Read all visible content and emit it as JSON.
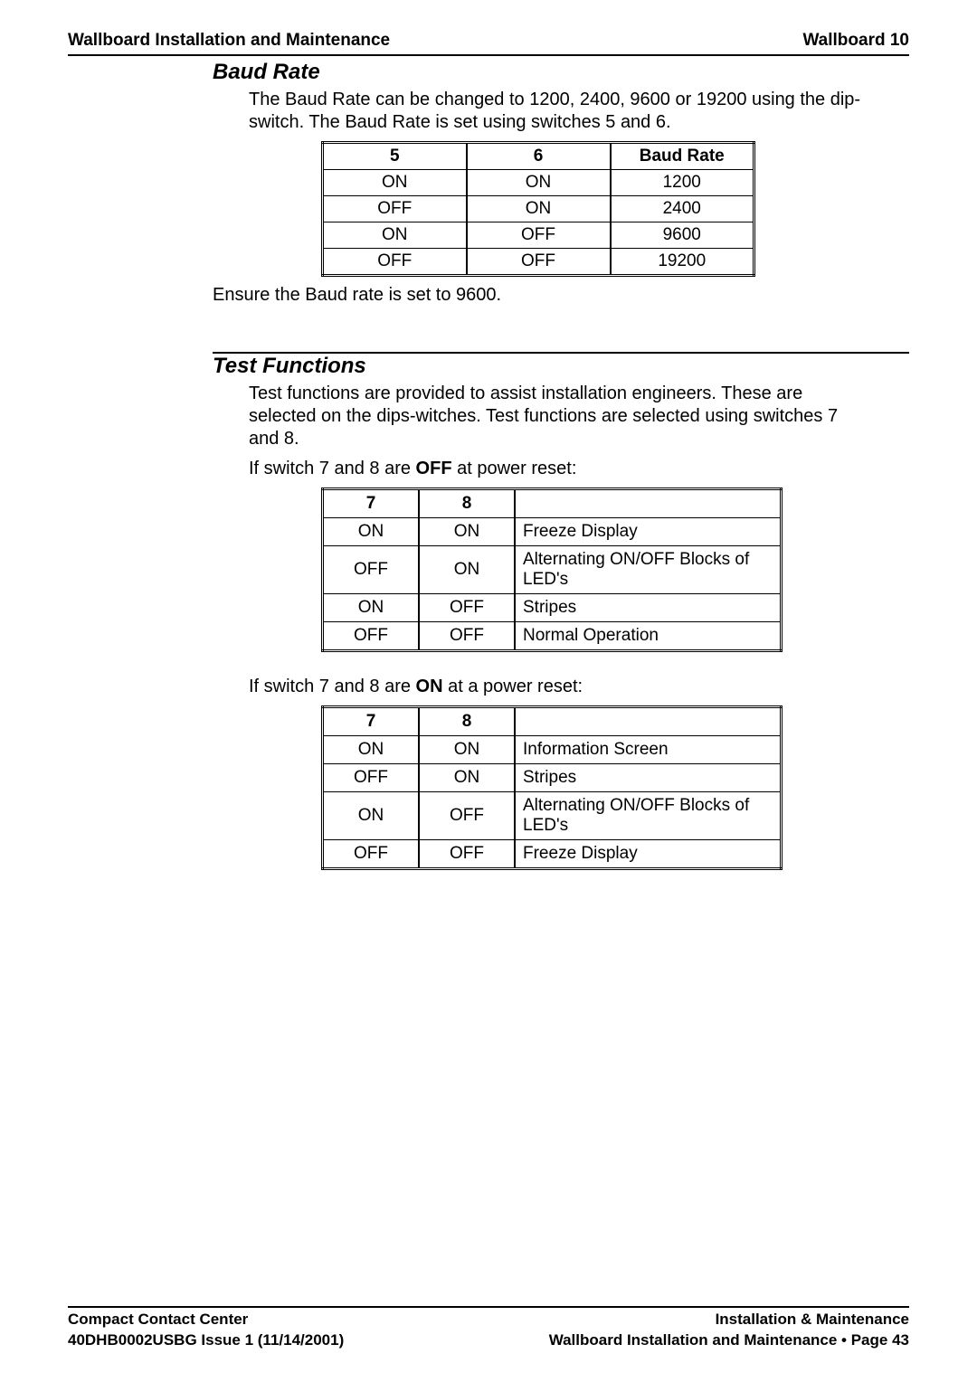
{
  "header": {
    "left": "Wallboard Installation and Maintenance",
    "right": "Wallboard 10"
  },
  "section1": {
    "title": "Baud Rate",
    "intro": "The Baud Rate can be changed to 1200, 2400, 9600 or 19200 using the dip-switch.  The Baud Rate is set using switches 5 and 6.",
    "note": "Ensure the Baud rate is set to 9600."
  },
  "chart_data": [
    {
      "type": "table",
      "title": "Baud Rate dip-switch settings (switches 5 & 6)",
      "headers": [
        "5",
        "6",
        "Baud Rate"
      ],
      "rows": [
        [
          "ON",
          "ON",
          "1200"
        ],
        [
          "OFF",
          "ON",
          "2400"
        ],
        [
          "ON",
          "OFF",
          "9600"
        ],
        [
          "OFF",
          "OFF",
          "19200"
        ]
      ]
    },
    {
      "type": "table",
      "title": "Test functions when switches 7 & 8 are OFF at power reset",
      "headers": [
        "7",
        "8",
        ""
      ],
      "rows": [
        [
          "ON",
          "ON",
          "Freeze Display"
        ],
        [
          "OFF",
          "ON",
          "Alternating ON/OFF Blocks of LED's"
        ],
        [
          "ON",
          "OFF",
          "Stripes"
        ],
        [
          "OFF",
          "OFF",
          "Normal Operation"
        ]
      ]
    },
    {
      "type": "table",
      "title": "Test functions when switches 7 & 8 are ON at power reset",
      "headers": [
        "7",
        "8",
        ""
      ],
      "rows": [
        [
          "ON",
          "ON",
          "Information Screen"
        ],
        [
          "OFF",
          "ON",
          "Stripes"
        ],
        [
          "ON",
          "OFF",
          "Alternating ON/OFF Blocks of LED's"
        ],
        [
          "OFF",
          "OFF",
          "Freeze Display"
        ]
      ]
    }
  ],
  "section2": {
    "title": "Test Functions",
    "intro": "Test functions are provided to assist installation engineers.  These are selected on the dips-witches.  Test functions are selected using switches 7 and 8.",
    "cond_off_pre": "If switch 7 and 8 are ",
    "cond_off_bold": "OFF",
    "cond_off_post": " at power reset:",
    "cond_on_pre": "If switch 7 and 8 are ",
    "cond_on_bold": "ON",
    "cond_on_post": " at a power reset:"
  },
  "footer": {
    "left1": "Compact Contact Center",
    "left2": "40DHB0002USBG Issue 1 (11/14/2001)",
    "right1": "Installation & Maintenance",
    "right2a": "Wallboard Installation and Maintenance ",
    "right2b": " Page 43"
  }
}
